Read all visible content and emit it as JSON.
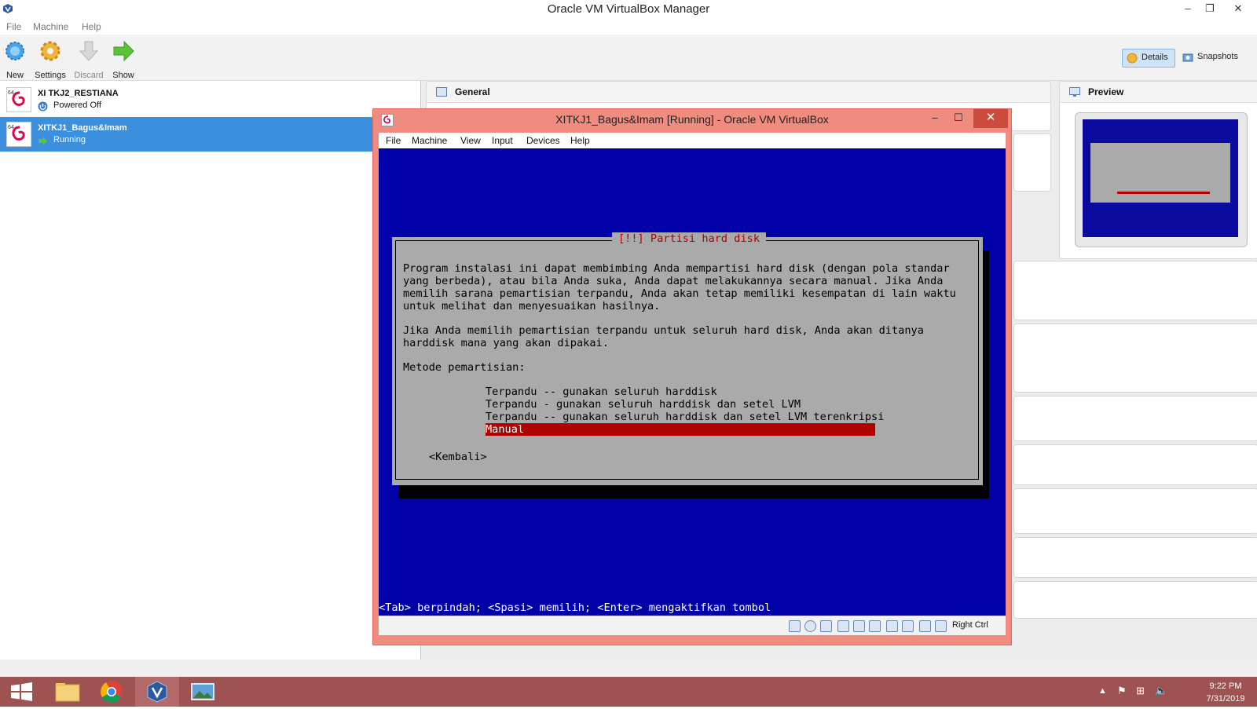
{
  "manager": {
    "title": "Oracle VM VirtualBox Manager",
    "menu": [
      "File",
      "Machine",
      "Help"
    ],
    "toolbar": {
      "new": "New",
      "settings": "Settings",
      "discard": "Discard",
      "show": "Show"
    },
    "view_switch": {
      "details": "Details",
      "snapshots": "Snapshots"
    },
    "vms": [
      {
        "name": "XI TKJ2_RESTIANA",
        "state": "Powered Off",
        "os_badge": "64"
      },
      {
        "name": "XITKJ1_Bagus&Imam",
        "state": "Running",
        "os_badge": "64"
      }
    ],
    "panes": {
      "general": "General",
      "preview": "Preview"
    }
  },
  "vm_window": {
    "title": "XITKJ1_Bagus&Imam [Running] - Oracle VM VirtualBox",
    "menu": [
      "File",
      "Machine",
      "View",
      "Input",
      "Devices",
      "Help"
    ],
    "host_key": "Right Ctrl"
  },
  "installer": {
    "dialog_title": "[!!] Partisi hard disk",
    "lines": [
      "Program instalasi ini dapat membimbing Anda mempartisi hard disk (dengan pola standar",
      "yang berbeda), atau bila Anda suka, Anda dapat melakukannya secara manual. Jika Anda",
      "memilih sarana pemartisian terpandu, Anda akan tetap memiliki kesempatan di lain waktu",
      "untuk melihat dan menyesuaikan hasilnya.",
      "Jika Anda memilih pemartisian terpandu untuk seluruh hard disk, Anda akan ditanya",
      "harddisk mana yang akan dipakai.",
      "Metode pemartisian:"
    ],
    "options": [
      "Terpandu -- gunakan seluruh harddisk",
      "Terpandu - gunakan seluruh harddisk dan setel LVM",
      "Terpandu -- gunakan seluruh harddisk dan setel LVM terenkripsi",
      "Manual"
    ],
    "selected_option": "Manual",
    "back_button": "<Kembali>",
    "hint": "<Tab> berpindah; <Spasi> memilih; <Enter> mengaktifkan tombol"
  },
  "taskbar": {
    "time": "9:22 PM",
    "date": "7/31/2019"
  },
  "colors": {
    "installer_bg": "#0000a8",
    "dialog_bg": "#aaaaaa",
    "selection": "#b00000",
    "vm_frame": "#f08b80",
    "taskbar": "#9e5252",
    "selected_vm": "#3b8fdc"
  },
  "icons": [
    "virtualbox-icon",
    "new-icon",
    "settings-icon",
    "discard-icon",
    "show-icon",
    "details-icon",
    "snapshots-icon",
    "debian-icon",
    "power-off-icon",
    "running-icon",
    "start-icon",
    "folder-icon",
    "chrome-icon",
    "virtualbox-taskbar-icon",
    "image-viewer-icon"
  ]
}
